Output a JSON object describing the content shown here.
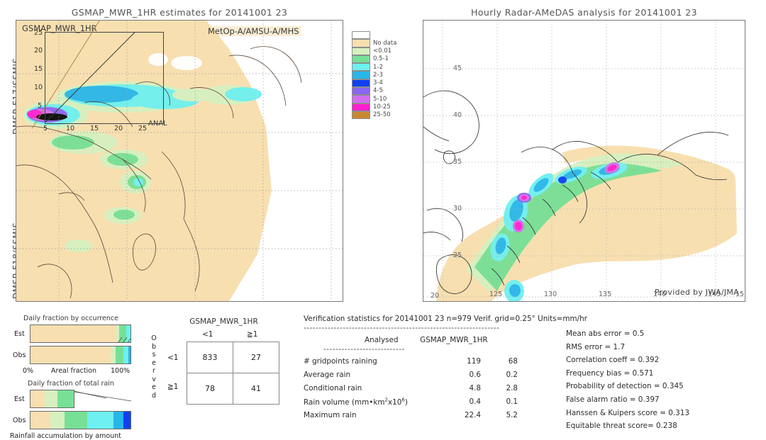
{
  "left_panel": {
    "title": "GSMAP_MWR_1HR estimates for 20141001 23",
    "map_tag": "GSMAP_MWR_1HR",
    "sensor_tag": "MetOp-A/AMSU-A/MHS",
    "side_label_top": "DMSP-F17/SSMIS",
    "side_label_bottom": "DMSP-F18/SSMIS",
    "inset": {
      "anal_label": "ANAL",
      "y_ticks": [
        "25",
        "20",
        "15",
        "10",
        "5"
      ],
      "x_ticks": [
        "5",
        "10",
        "15",
        "20",
        "25"
      ]
    }
  },
  "colorbar": {
    "items": [
      {
        "label": "",
        "color": "#ffffff"
      },
      {
        "label": "No data",
        "color": "#f7dfb0"
      },
      {
        "label": "<0.01",
        "color": "#d6f0c0"
      },
      {
        "label": "0.5-1",
        "color": "#77e096"
      },
      {
        "label": "1-2",
        "color": "#6ef0f0"
      },
      {
        "label": "2-3",
        "color": "#29b6e8"
      },
      {
        "label": "3-4",
        "color": "#1040f0"
      },
      {
        "label": "4-5",
        "color": "#8a66f0"
      },
      {
        "label": "5-10",
        "color": "#d46ef0"
      },
      {
        "label": "10-25",
        "color": "#ff20d0"
      },
      {
        "label": "25-50",
        "color": "#c88a30"
      }
    ]
  },
  "right_panel": {
    "title": "Hourly Radar-AMeDAS analysis for 20141001 23",
    "credit": "Provided by JWA/JMA",
    "lat_ticks": [
      "45",
      "40",
      "35",
      "30",
      "25",
      "20"
    ],
    "lon_ticks": [
      "125",
      "130",
      "135",
      "140",
      "145",
      "15"
    ]
  },
  "bars": {
    "chart1_title": "Daily fraction by occurrence",
    "chart1_axis": "Areal fraction",
    "chart1_min": "0%",
    "chart1_max": "100%",
    "chart2_title": "Daily fraction of total rain",
    "chart2_axis": "Rainfall accumulation by amount",
    "row_est": "Est",
    "row_obs": "Obs"
  },
  "table": {
    "title": "GSMAP_MWR_1HR",
    "col_headers": [
      "<1",
      "≧1"
    ],
    "row_headers": [
      "<1",
      "≧1"
    ],
    "observed_label": "Observed",
    "cells": [
      [
        "833",
        "27"
      ],
      [
        "78",
        "41"
      ]
    ]
  },
  "stats": {
    "header": "Verification statistics for 20141001 23  n=979  Verif. grid=0.25°  Units=mm/hr",
    "divider": "-----------------------------------------------------------------",
    "col_label_analysed": "Analysed",
    "col_label_model": "GSMAP_MWR_1HR",
    "divider2": "---------------------------",
    "rows": [
      {
        "label": "# gridpoints raining",
        "analysed": "119",
        "model": "68"
      },
      {
        "label": "Average rain",
        "analysed": "0.6",
        "model": "0.2"
      },
      {
        "label": "Conditional rain",
        "analysed": "4.8",
        "model": "2.8"
      },
      {
        "label": "Rain volume (mm*km²x10⁶)",
        "analysed": "0.4",
        "model": "0.1"
      },
      {
        "label": "Maximum rain",
        "analysed": "22.4",
        "model": "5.2"
      }
    ],
    "scores": [
      "Mean abs error = 0.5",
      "RMS error = 1.7",
      "Correlation coeff = 0.392",
      "Frequency bias = 0.571",
      "Probability of detection = 0.345",
      "False alarm ratio = 0.397",
      "Hanssen & Kuipers score = 0.313",
      "Equitable threat score= 0.238"
    ]
  }
}
